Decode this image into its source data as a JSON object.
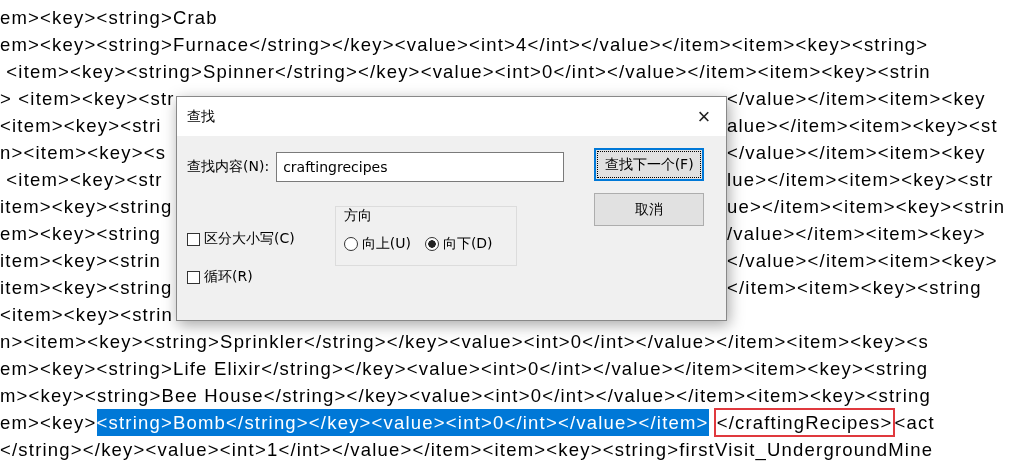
{
  "editor": {
    "lines": [
      {
        "segments": [
          {
            "kind": "plain",
            "text": "em><key><string>Crab"
          }
        ]
      },
      {
        "segments": [
          {
            "kind": "plain",
            "text": "em><key><string>Furnace</string></key><value><int>4</int></value></item><item><key><string>"
          }
        ]
      },
      {
        "segments": [
          {
            "kind": "plain",
            "text": " <item><key><string>Spinner</string></key><value><int>0</int></value></item><item><key><strin"
          }
        ]
      },
      {
        "segments": [
          {
            "kind": "plain",
            "text": "> <item><key><str"
          },
          {
            "kind": "hidden"
          },
          {
            "kind": "plain",
            "text": "</value></item><item><key"
          }
        ]
      },
      {
        "segments": [
          {
            "kind": "plain",
            "text": "<item><key><stri"
          },
          {
            "kind": "hidden"
          },
          {
            "kind": "plain",
            "text": "alue></item><item><key><st"
          }
        ]
      },
      {
        "segments": [
          {
            "kind": "plain",
            "text": "n><item><key><s"
          },
          {
            "kind": "hidden"
          },
          {
            "kind": "plain",
            "text": "</value></item><item><key"
          }
        ]
      },
      {
        "segments": [
          {
            "kind": "plain",
            "text": " <item><key><str"
          },
          {
            "kind": "hidden"
          },
          {
            "kind": "plain",
            "text": "lue></item><item><key><str"
          }
        ]
      },
      {
        "segments": [
          {
            "kind": "plain",
            "text": "item><key><string"
          },
          {
            "kind": "hidden"
          },
          {
            "kind": "plain",
            "text": "ue></item><item><key><strin"
          }
        ]
      },
      {
        "segments": [
          {
            "kind": "plain",
            "text": "em><key><string"
          },
          {
            "kind": "hidden"
          },
          {
            "kind": "plain",
            "text": "/value></item><item><key>"
          }
        ]
      },
      {
        "segments": [
          {
            "kind": "plain",
            "text": "item><key><strin"
          },
          {
            "kind": "hidden"
          },
          {
            "kind": "plain",
            "text": "</value></item><item><key>"
          }
        ]
      },
      {
        "segments": [
          {
            "kind": "plain",
            "text": "item><key><string"
          },
          {
            "kind": "hidden"
          },
          {
            "kind": "plain",
            "text": "</item><item><key><string"
          }
        ]
      },
      {
        "segments": [
          {
            "kind": "plain",
            "text": "<item><key><strin"
          },
          {
            "kind": "hidden"
          }
        ]
      },
      {
        "segments": [
          {
            "kind": "plain",
            "text": "n><item><key><string>Sprinkler</string></key><value><int>0</int></value></item><item><key><s"
          }
        ]
      },
      {
        "segments": [
          {
            "kind": "plain",
            "text": "em><key><string>Life Elixir</string></key><value><int>0</int></value></item><item><key><string"
          }
        ]
      },
      {
        "segments": [
          {
            "kind": "plain",
            "text": "m><key><string>Bee House</string></key><value><int>0</int></value></item><item><key><string"
          }
        ]
      },
      {
        "segments": [
          {
            "kind": "plain",
            "text": "em><key>"
          },
          {
            "kind": "selected",
            "text": "<string>Bomb</string></key><value><int>0</int></value></item>"
          },
          {
            "kind": "match",
            "text": "</craftingRecipes>"
          },
          {
            "kind": "plain",
            "text": "<act"
          }
        ]
      },
      {
        "segments": [
          {
            "kind": "plain",
            "text": "</string></key><value><int>1</int></value></item><item><key><string>firstVisit_UndergroundMine"
          }
        ]
      }
    ]
  },
  "dialog": {
    "title": "查找",
    "close": "×",
    "find_label": "查找内容(N):",
    "find_value": "craftingrecipes",
    "options": [
      {
        "label": "区分大小写(C)",
        "checked": false
      },
      {
        "label": "循环(R)",
        "checked": false
      }
    ],
    "direction": {
      "title": "方向",
      "options": [
        {
          "label": "向上(U)",
          "selected": false
        },
        {
          "label": "向下(D)",
          "selected": true
        }
      ]
    },
    "buttons": [
      {
        "label": "查找下一个(F)",
        "default": true
      },
      {
        "label": "取消",
        "default": false
      }
    ]
  }
}
